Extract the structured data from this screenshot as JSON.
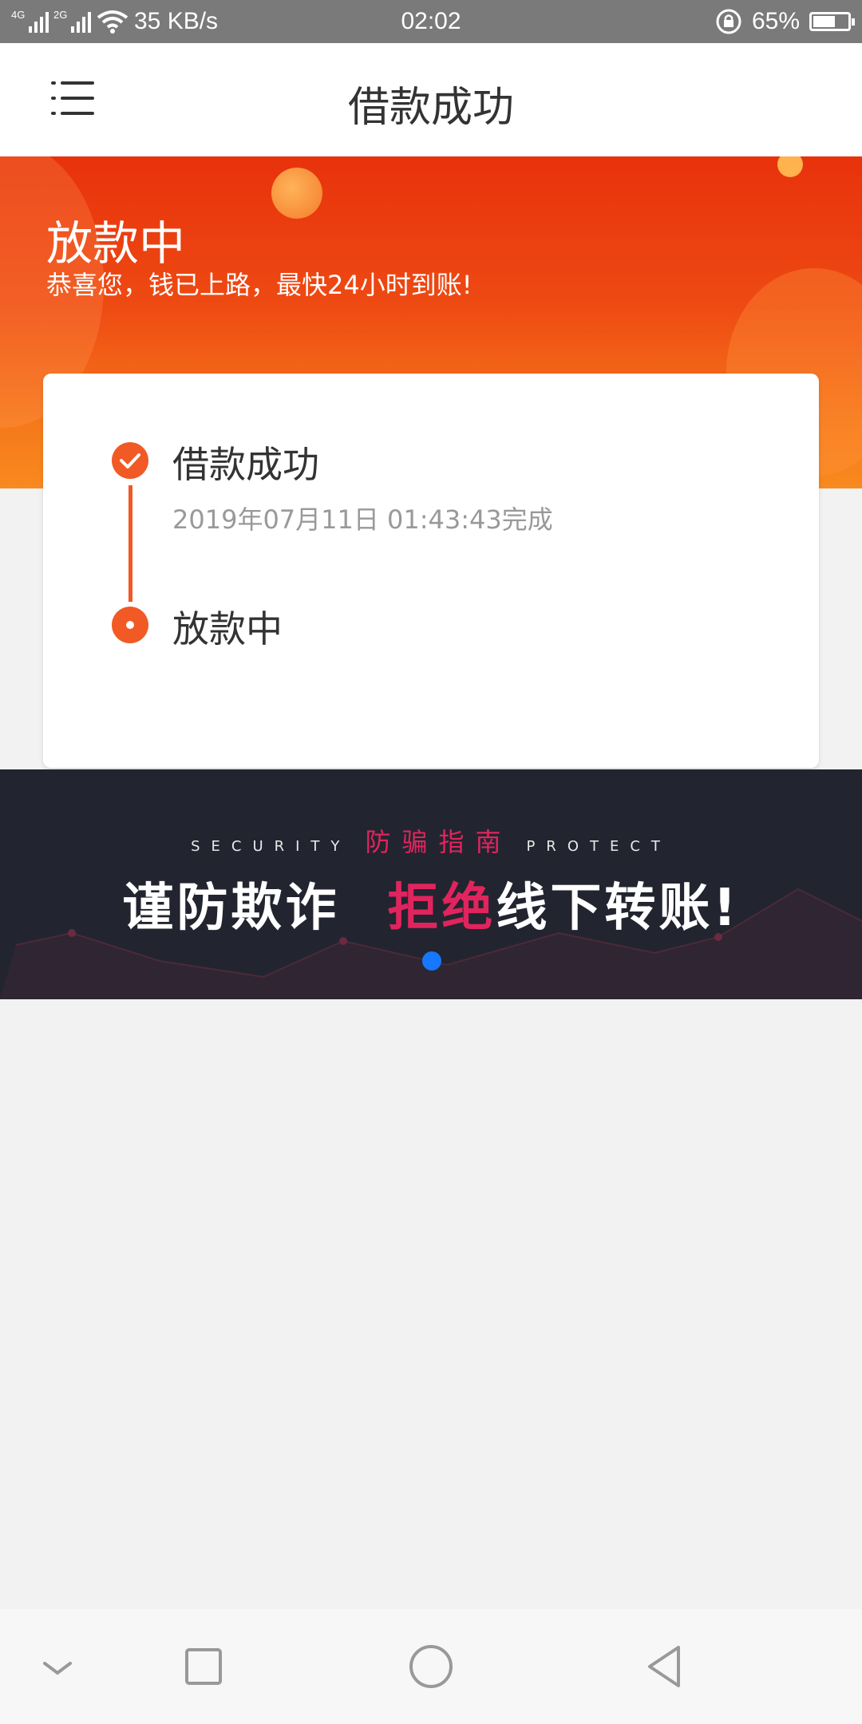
{
  "status_bar": {
    "net1": "4G",
    "net2": "2G",
    "speed": "35 KB/s",
    "time": "02:02",
    "battery": "65%",
    "battery_level": 0.65
  },
  "header": {
    "title": "借款成功"
  },
  "hero": {
    "title": "放款中",
    "subtitle": "恭喜您，钱已上路，最快24小时到账!"
  },
  "progress": {
    "steps": [
      {
        "label": "借款成功",
        "time": "2019年07月11日 01:43:43完成"
      },
      {
        "label": "放款中"
      }
    ]
  },
  "banner": {
    "left_text": "SECURITY",
    "center_text": "防骗指南",
    "right_text": "PROTECT",
    "headline_white1": "谨防欺诈",
    "headline_red": "拒绝",
    "headline_white2": "线下转账!",
    "dot_color": "#1677ff"
  },
  "colors": {
    "accent": "#f15a24",
    "banner_red": "#e0245e"
  },
  "nav": {
    "icons": [
      "chevron-down-icon",
      "square-icon",
      "circle-icon",
      "back-triangle-icon"
    ]
  }
}
